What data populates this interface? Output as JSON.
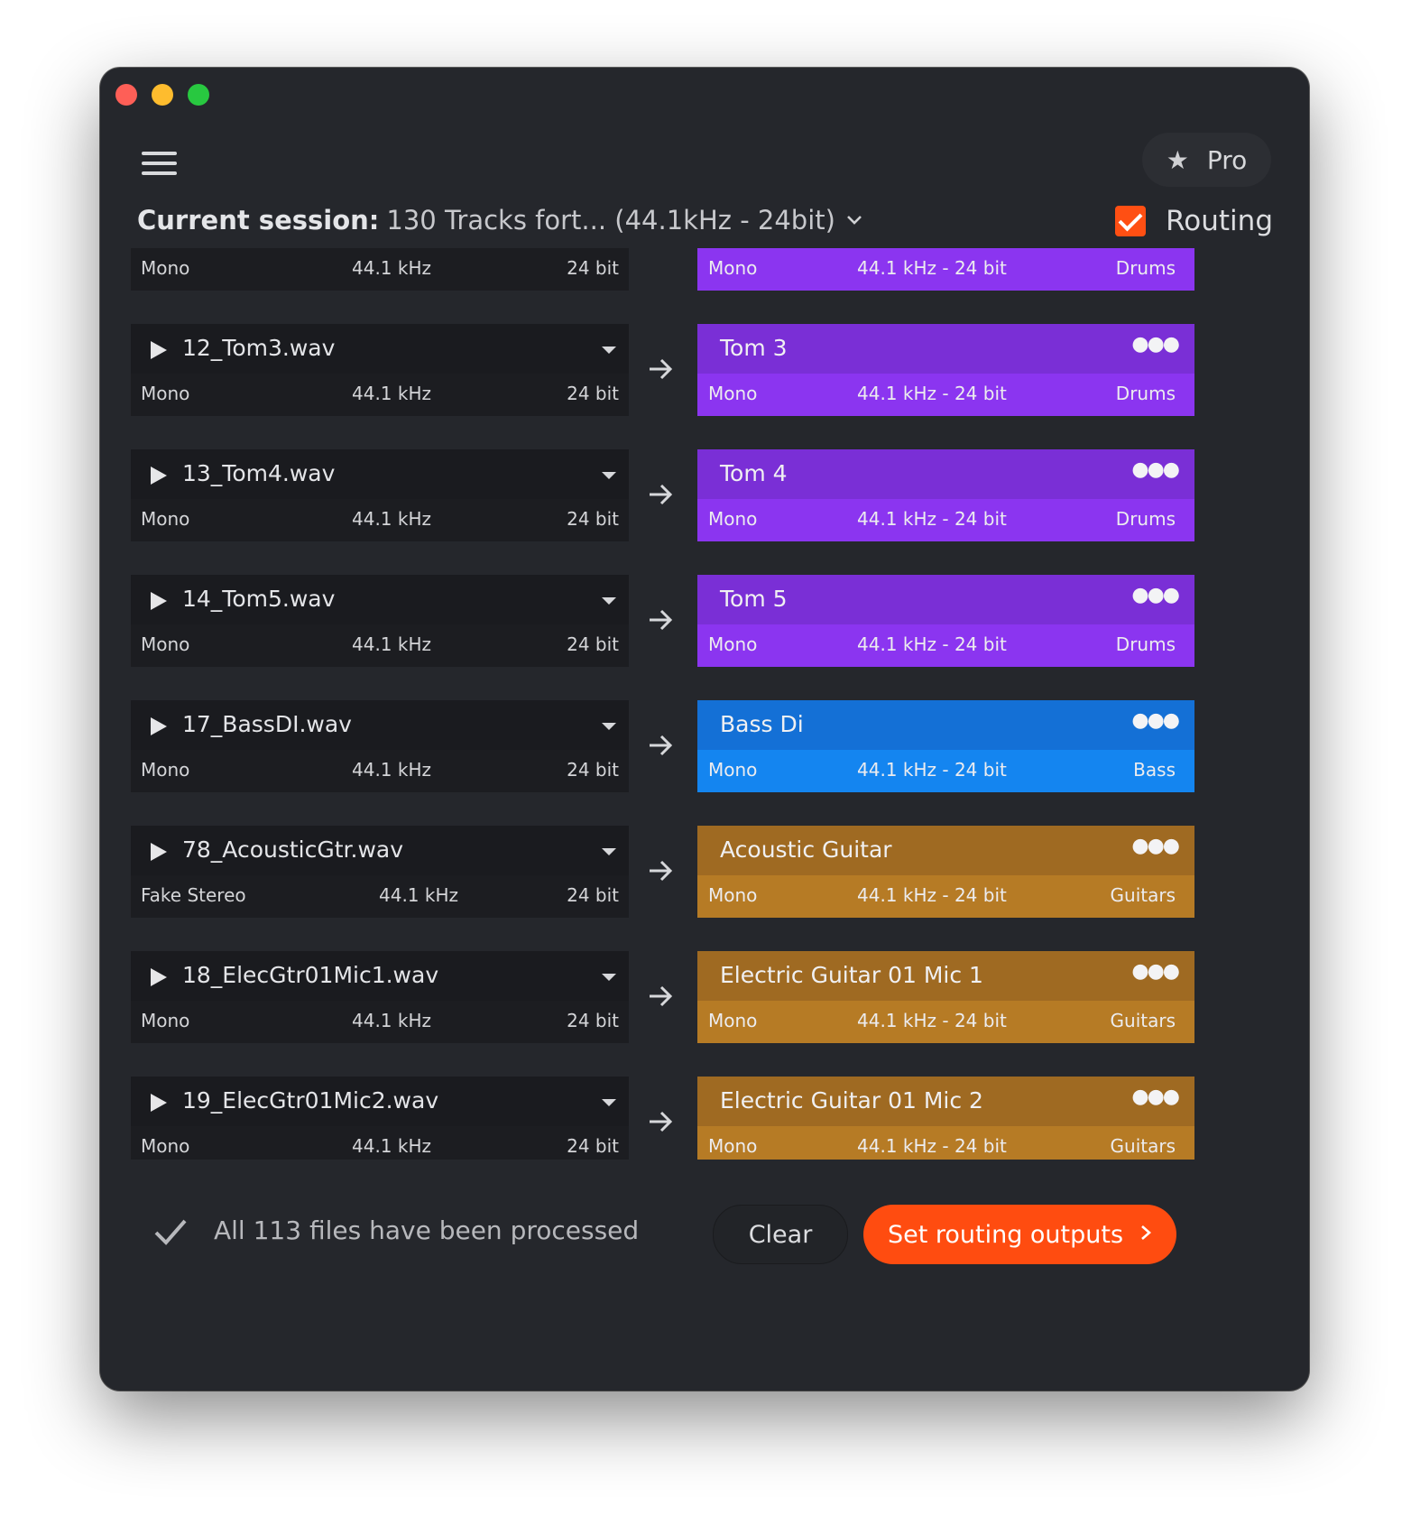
{
  "header": {
    "pro_label": "Pro",
    "pro_icon": "star-icon",
    "session_prefix": "Current session:",
    "session_value": "130 Tracks fort... (44.1kHz - 24bit)",
    "routing_label": "Routing",
    "routing_checked": true
  },
  "rows": [
    {
      "file": "",
      "src_channel": "Mono",
      "src_rate": "44.1 kHz",
      "src_bits": "24 bit",
      "dst_name": "",
      "dst_channel": "Mono",
      "dst_format": "44.1 kHz - 24 bit",
      "dst_group": "Drums",
      "top_color": "#7a2fd6",
      "bottom_color": "#8b35f0"
    },
    {
      "file": "12_Tom3.wav",
      "src_channel": "Mono",
      "src_rate": "44.1 kHz",
      "src_bits": "24 bit",
      "dst_name": "Tom 3",
      "dst_channel": "Mono",
      "dst_format": "44.1 kHz - 24 bit",
      "dst_group": "Drums",
      "top_color": "#7a2fd6",
      "bottom_color": "#8b35f0"
    },
    {
      "file": "13_Tom4.wav",
      "src_channel": "Mono",
      "src_rate": "44.1 kHz",
      "src_bits": "24 bit",
      "dst_name": "Tom 4",
      "dst_channel": "Mono",
      "dst_format": "44.1 kHz - 24 bit",
      "dst_group": "Drums",
      "top_color": "#7a2fd6",
      "bottom_color": "#8b35f0"
    },
    {
      "file": "14_Tom5.wav",
      "src_channel": "Mono",
      "src_rate": "44.1 kHz",
      "src_bits": "24 bit",
      "dst_name": "Tom 5",
      "dst_channel": "Mono",
      "dst_format": "44.1 kHz - 24 bit",
      "dst_group": "Drums",
      "top_color": "#7a2fd6",
      "bottom_color": "#8b35f0"
    },
    {
      "file": "17_BassDI.wav",
      "src_channel": "Mono",
      "src_rate": "44.1 kHz",
      "src_bits": "24 bit",
      "dst_name": "Bass Di",
      "dst_channel": "Mono",
      "dst_format": "44.1 kHz - 24 bit",
      "dst_group": "Bass",
      "top_color": "#1470d6",
      "bottom_color": "#1485f0"
    },
    {
      "file": "78_AcousticGtr.wav",
      "src_channel": "Fake Stereo",
      "src_rate": "44.1 kHz",
      "src_bits": "24 bit",
      "dst_name": "Acoustic Guitar",
      "dst_channel": "Mono",
      "dst_format": "44.1 kHz - 24 bit",
      "dst_group": "Guitars",
      "top_color": "#9f6a22",
      "bottom_color": "#b67b25"
    },
    {
      "file": "18_ElecGtr01Mic1.wav",
      "src_channel": "Mono",
      "src_rate": "44.1 kHz",
      "src_bits": "24 bit",
      "dst_name": "Electric Guitar 01 Mic 1",
      "dst_channel": "Mono",
      "dst_format": "44.1 kHz - 24 bit",
      "dst_group": "Guitars",
      "top_color": "#9f6a22",
      "bottom_color": "#b67b25"
    },
    {
      "file": "19_ElecGtr01Mic2.wav",
      "src_channel": "Mono",
      "src_rate": "44.1 kHz",
      "src_bits": "24 bit",
      "dst_name": "Electric Guitar 01 Mic 2",
      "dst_channel": "Mono",
      "dst_format": "44.1 kHz - 24 bit",
      "dst_group": "Guitars",
      "top_color": "#9f6a22",
      "bottom_color": "#b67b25"
    }
  ],
  "footer": {
    "status_text": "All 113 files have been processed",
    "clear_label": "Clear",
    "set_label": "Set routing outputs"
  },
  "colors": {
    "accent": "#ff4c10",
    "window_bg": "#25272c"
  }
}
